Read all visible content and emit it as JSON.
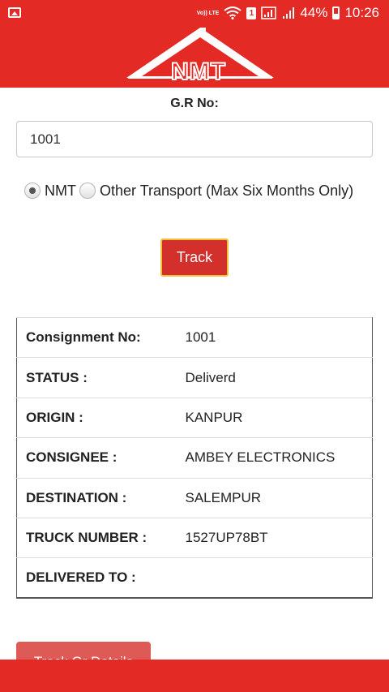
{
  "status_bar": {
    "volte": "Vo)) LTE",
    "sim": "1",
    "battery": "44%",
    "time": "10:26"
  },
  "header": {
    "logo_text": "NMT",
    "brand_color": "#e32a25"
  },
  "form": {
    "gr_label": "G.R No:",
    "gr_value": "1001",
    "radio_nmt": "NMT",
    "radio_other": "Other Transport (Max Six Months Only)",
    "selected": "NMT",
    "track_label": "Track"
  },
  "details": [
    {
      "label": "Consignment No:",
      "value": "1001"
    },
    {
      "label": "STATUS :",
      "value": "Deliverd"
    },
    {
      "label": "ORIGIN :",
      "value": "KANPUR"
    },
    {
      "label": "CONSIGNEE :",
      "value": "AMBEY ELECTRONICS"
    },
    {
      "label": "DESTINATION :",
      "value": "SALEMPUR"
    },
    {
      "label": "TRUCK NUMBER :",
      "value": "1527UP78BT"
    },
    {
      "label": "DELIVERED TO :",
      "value": ""
    }
  ],
  "track_gr_details_label": "Track Gr Details"
}
